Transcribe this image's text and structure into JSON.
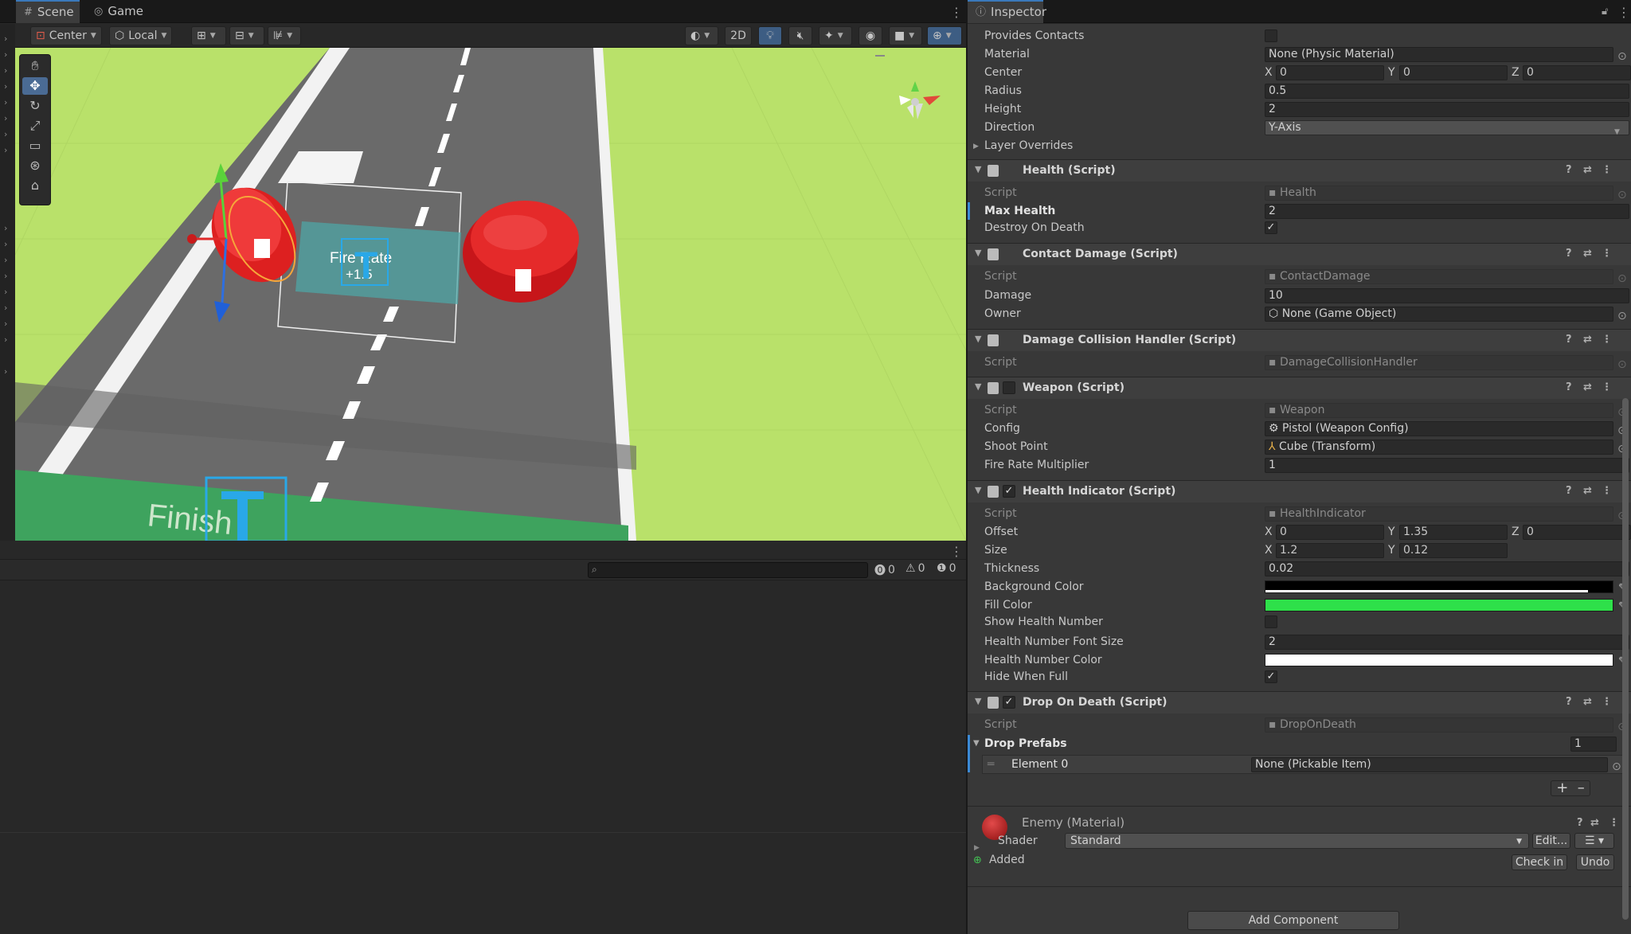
{
  "tabs": {
    "scene": "Scene",
    "game": "Game",
    "inspector": "Inspector"
  },
  "toolbar": {
    "pivot": "Center",
    "space": "Local",
    "mode_2d": "2D"
  },
  "scene": {
    "fire_rate_label": "Fire Rate",
    "fire_rate_value": "+1.5",
    "finish_label": "Finish"
  },
  "console": {
    "errors": "0",
    "warnings": "0",
    "messages": "0",
    "search_placeholder": ""
  },
  "collider": {
    "provides_contacts": {
      "label": "Provides Contacts",
      "checked": false
    },
    "material": {
      "label": "Material",
      "value": "None (Physic Material)"
    },
    "center": {
      "label": "Center",
      "x": "0",
      "y": "0",
      "z": "0"
    },
    "radius": {
      "label": "Radius",
      "value": "0.5"
    },
    "height": {
      "label": "Height",
      "value": "2"
    },
    "direction": {
      "label": "Direction",
      "value": "Y-Axis"
    },
    "layer_overrides": "Layer Overrides"
  },
  "health": {
    "title": "Health (Script)",
    "script": {
      "label": "Script",
      "value": "Health"
    },
    "max_health": {
      "label": "Max Health",
      "value": "2"
    },
    "destroy_on_death": {
      "label": "Destroy On Death",
      "checked": true
    }
  },
  "contact_damage": {
    "title": "Contact Damage (Script)",
    "script": {
      "label": "Script",
      "value": "ContactDamage"
    },
    "damage": {
      "label": "Damage",
      "value": "10"
    },
    "owner": {
      "label": "Owner",
      "value": "None (Game Object)"
    }
  },
  "damage_handler": {
    "title": "Damage Collision Handler (Script)",
    "script": {
      "label": "Script",
      "value": "DamageCollisionHandler"
    }
  },
  "weapon": {
    "title": "Weapon (Script)",
    "enabled": false,
    "script": {
      "label": "Script",
      "value": "Weapon"
    },
    "config": {
      "label": "Config",
      "value": "Pistol (Weapon Config)"
    },
    "shoot_point": {
      "label": "Shoot Point",
      "value": "Cube (Transform)"
    },
    "fire_rate_multiplier": {
      "label": "Fire Rate Multiplier",
      "value": "1"
    }
  },
  "health_indicator": {
    "title": "Health Indicator (Script)",
    "enabled": true,
    "script": {
      "label": "Script",
      "value": "HealthIndicator"
    },
    "offset": {
      "label": "Offset",
      "x": "0",
      "y": "1.35",
      "z": "0"
    },
    "size": {
      "label": "Size",
      "x": "1.2",
      "y": "0.12"
    },
    "thickness": {
      "label": "Thickness",
      "value": "0.02"
    },
    "background_color": {
      "label": "Background Color",
      "color": "#000000"
    },
    "fill_color": {
      "label": "Fill Color",
      "color": "#2ee04a"
    },
    "show_health_number": {
      "label": "Show Health Number",
      "checked": false
    },
    "font_size": {
      "label": "Health Number Font Size",
      "value": "2"
    },
    "number_color": {
      "label": "Health Number Color",
      "color": "#ffffff"
    },
    "hide_when_full": {
      "label": "Hide When Full",
      "checked": true
    }
  },
  "drop_on_death": {
    "title": "Drop On Death (Script)",
    "enabled": true,
    "script": {
      "label": "Script",
      "value": "DropOnDeath"
    },
    "drop_prefabs": {
      "label": "Drop Prefabs",
      "count": "1"
    },
    "element0": {
      "label": "Element 0",
      "value": "None (Pickable Item)"
    }
  },
  "material": {
    "title": "Enemy (Material)",
    "shader_label": "Shader",
    "shader_value": "Standard",
    "edit_label": "Edit...",
    "status": "Added",
    "check_in": "Check in",
    "undo": "Undo"
  },
  "add_component": "Add Component",
  "colors": {
    "accent": "#3a79bb",
    "ground": "#b9e16a",
    "road": "#6b6b6b",
    "enemy": "#d51c1c"
  }
}
